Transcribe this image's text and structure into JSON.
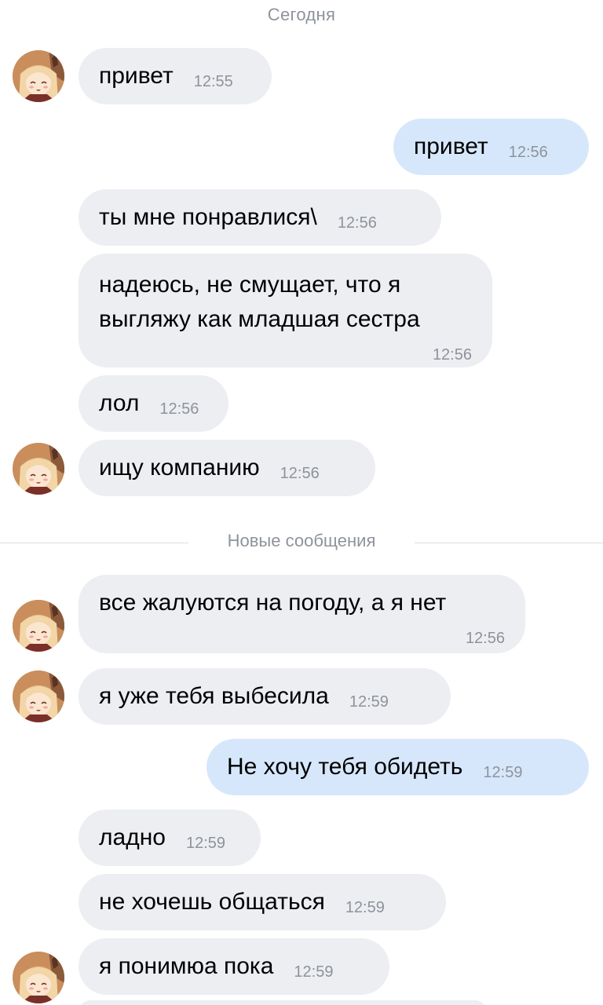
{
  "separators": {
    "date": "Сегодня",
    "new_messages": "Новые сообщения"
  },
  "messages": [
    {
      "text": "привет",
      "time": "12:55"
    },
    {
      "text": "привет",
      "time": "12:56"
    },
    {
      "text": "ты мне понравлися\\",
      "time": "12:56"
    },
    {
      "text": "надеюсь, не смущает, что я выгляжу как младшая сестра",
      "time": "12:56"
    },
    {
      "text": "лол",
      "time": "12:56"
    },
    {
      "text": "ищу компанию",
      "time": "12:56"
    },
    {
      "text": "все жалуются на погоду, а я нет",
      "time": "12:56"
    },
    {
      "text": "я уже тебя выбесила",
      "time": "12:59"
    },
    {
      "text": "Не хочу тебя обидеть",
      "time": "12:59"
    },
    {
      "text": "ладно",
      "time": "12:59"
    },
    {
      "text": "не хочешь общаться",
      "time": "12:59"
    },
    {
      "text": "я понимюа пока",
      "time": "12:59"
    }
  ],
  "colors": {
    "incoming_bubble": "#eceef2",
    "outgoing_bubble": "#d7e7fb",
    "meta_text": "#8e939a"
  }
}
